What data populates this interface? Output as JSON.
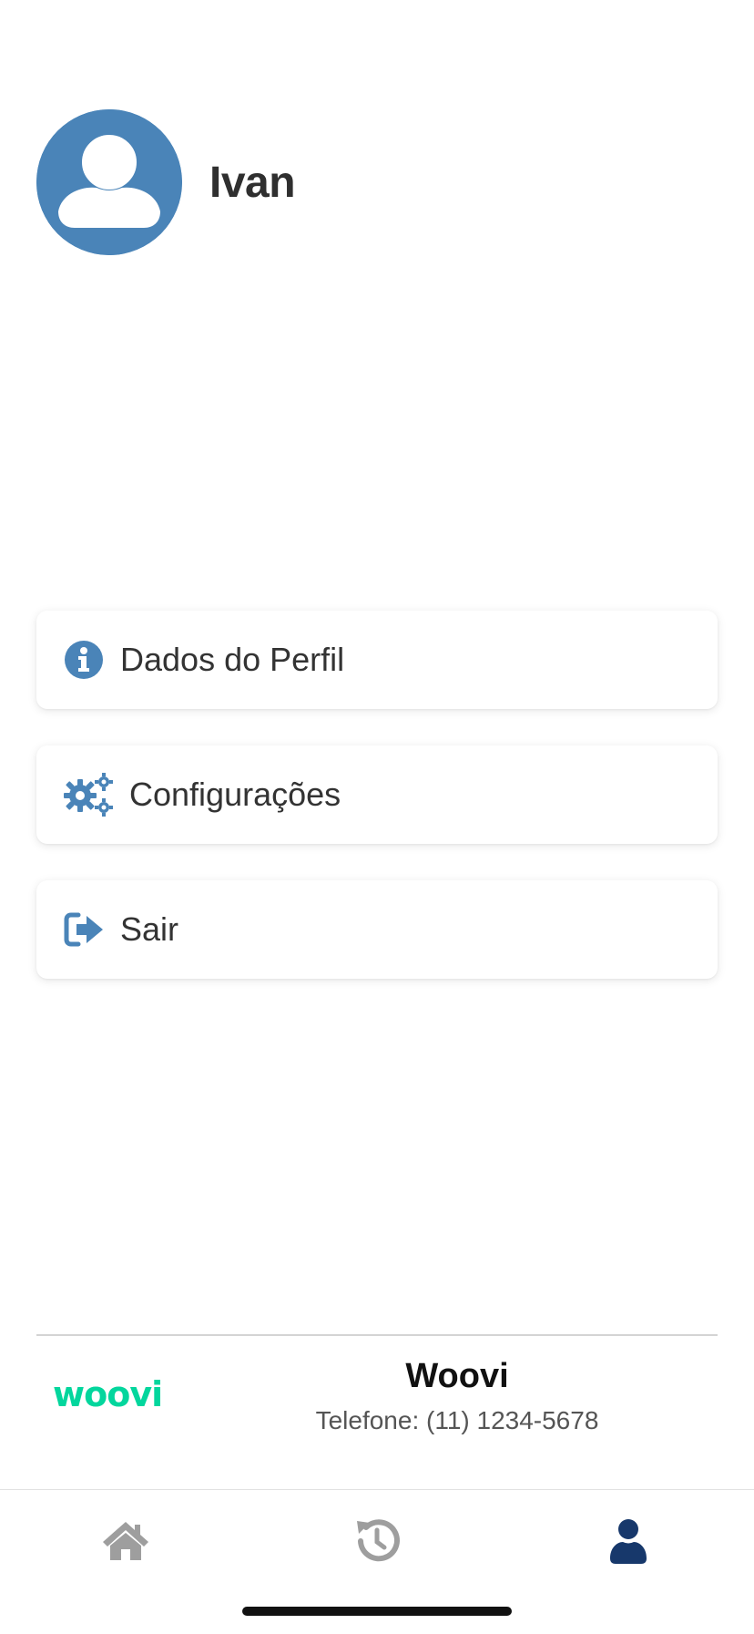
{
  "profile": {
    "name": "Ivan",
    "avatar_icon": "user-avatar-icon"
  },
  "menu": {
    "items": [
      {
        "label": "Dados do Perfil",
        "icon": "info-circle-icon"
      },
      {
        "label": "Configurações",
        "icon": "gears-icon"
      },
      {
        "label": "Sair",
        "icon": "sign-out-icon"
      }
    ]
  },
  "footer": {
    "logo_text": "woovi",
    "company_name": "Woovi",
    "phone": "Telefone: (11) 1234-5678"
  },
  "tabbar": {
    "tabs": [
      {
        "name": "home",
        "icon": "home-icon",
        "active": false
      },
      {
        "name": "history",
        "icon": "history-icon",
        "active": false
      },
      {
        "name": "profile",
        "icon": "user-icon",
        "active": true
      }
    ]
  },
  "colors": {
    "accent": "#4a84b8",
    "brand": "#03d69d",
    "tab_active": "#17386b",
    "tab_inactive": "#9e9e9e"
  }
}
